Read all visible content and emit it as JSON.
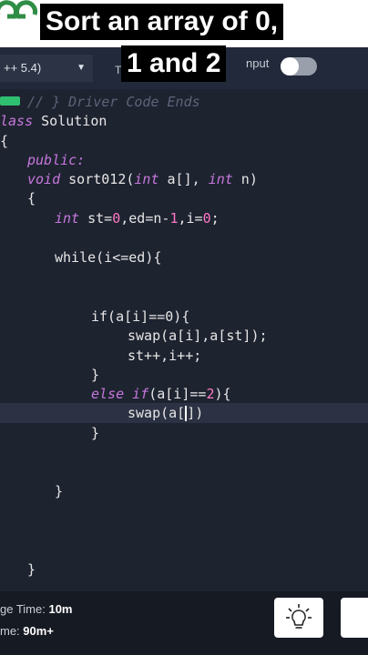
{
  "header": {
    "title_line1": "Sort an array of 0,",
    "title_line2": "1 and 2"
  },
  "toolbar": {
    "language": "++ 5.4)",
    "fragment": "T",
    "input_label": "nput",
    "input_toggle_on": false
  },
  "editor": {
    "lines": {
      "l01": "// } Driver Code Ends",
      "l02a": "lass",
      "l02b": " Solution",
      "l03": "{",
      "l04": "public:",
      "l05a": "void",
      "l05b": " sort012(",
      "l05c": "int",
      "l05d": " a[], ",
      "l05e": "int",
      "l05f": " n)",
      "l06": "{",
      "l07a": "int",
      "l07b": " st=",
      "l07c": "0",
      "l07d": ",ed=n-",
      "l07e": "1",
      "l07f": ",i=",
      "l07g": "0",
      "l07h": ";",
      "l08": "while(i<=ed){",
      "l09": "if(a[i]==0){",
      "l10": "swap(a[i],a[st]);",
      "l11": "st++,i++;",
      "l12": "}",
      "l13a": "else if",
      "l13b": "(a[i]==",
      "l13c": "2",
      "l13d": "){",
      "l14a": "swap(a[",
      "l14b": "])",
      "l15": "}",
      "l16": "}",
      "l17": "}"
    }
  },
  "footer": {
    "line1_label": "ge Time: ",
    "line1_value": "10m",
    "line2_label": "me: ",
    "line2_value": "90m+"
  },
  "colors": {
    "brand_green": "#2fbf71",
    "editor_bg": "#1e2330",
    "keyword": "#c678dd"
  }
}
